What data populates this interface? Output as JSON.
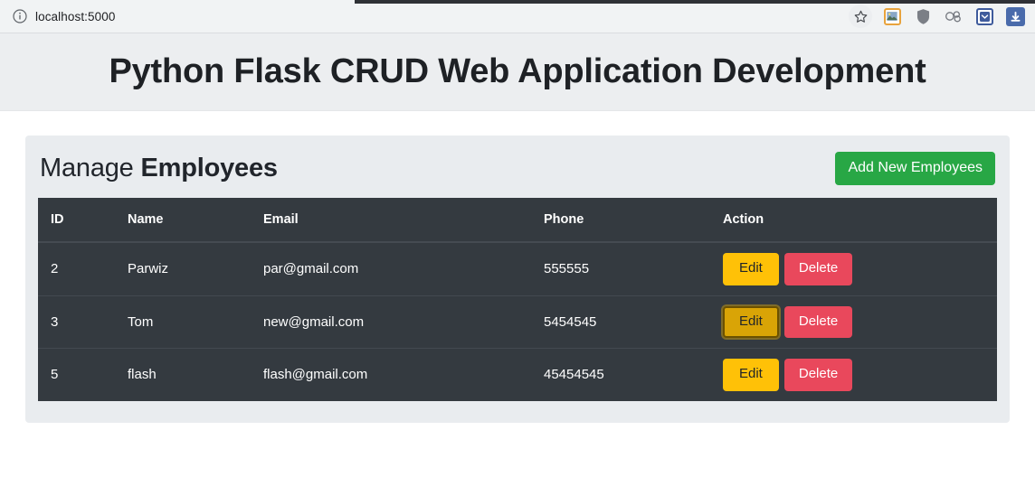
{
  "browser": {
    "url": "localhost:5000",
    "info_icon": "info-circle-icon",
    "actions": [
      {
        "name": "bookmark-star-icon",
        "label": ""
      },
      {
        "name": "photo-extension-icon",
        "label": ""
      },
      {
        "name": "shield-extension-icon",
        "label": ""
      },
      {
        "name": "cloud-extension-icon",
        "label": ""
      },
      {
        "name": "pocket-extension-icon",
        "label": ""
      },
      {
        "name": "download-extension-icon",
        "label": ""
      }
    ]
  },
  "page": {
    "title": "Python Flask CRUD Web Application Development"
  },
  "section": {
    "title_light": "Manage",
    "title_bold": "Employees",
    "add_button": "Add New Employees"
  },
  "table": {
    "columns": [
      "ID",
      "Name",
      "Email",
      "Phone",
      "Action"
    ],
    "rows": [
      {
        "id": "2",
        "name": "Parwiz",
        "email": "par@gmail.com",
        "phone": "555555",
        "edit_label": "Edit",
        "delete_label": "Delete",
        "edit_focused": false
      },
      {
        "id": "3",
        "name": "Tom",
        "email": "new@gmail.com",
        "phone": "5454545",
        "edit_label": "Edit",
        "delete_label": "Delete",
        "edit_focused": true
      },
      {
        "id": "5",
        "name": "flash",
        "email": "flash@gmail.com",
        "phone": "45454545",
        "edit_label": "Edit",
        "delete_label": "Delete",
        "edit_focused": false
      }
    ]
  },
  "colors": {
    "header_band": "#eceef0",
    "card_bg": "#e9ecef",
    "table_bg": "#343a40",
    "add_green": "#28a745",
    "edit_yellow": "#ffc107",
    "edit_yellow_focused": "#d9a406",
    "delete_red": "#e9485c",
    "text_dark": "#21252b"
  }
}
